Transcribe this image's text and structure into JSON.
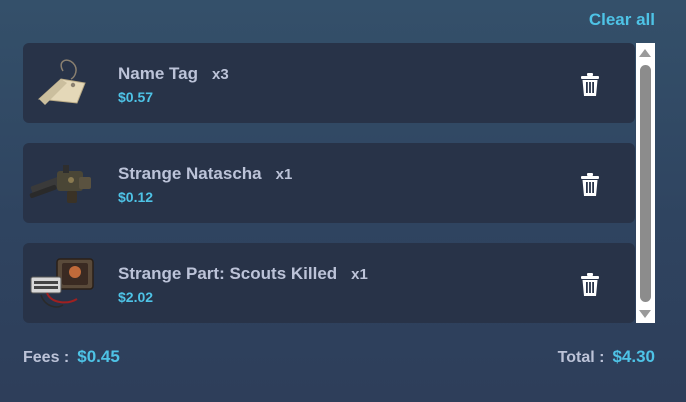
{
  "header": {
    "clear_all_label": "Clear all"
  },
  "cart": {
    "items": [
      {
        "name": "Name Tag",
        "qty": "x3",
        "price": "$0.57",
        "icon": "name-tag-icon"
      },
      {
        "name": "Strange Natascha",
        "qty": "x1",
        "price": "$0.12",
        "icon": "minigun-icon"
      },
      {
        "name": "Strange Part: Scouts Killed",
        "qty": "x1",
        "price": "$2.02",
        "icon": "strange-part-icon"
      }
    ]
  },
  "summary": {
    "fees_label": "Fees :",
    "fees_value": "$0.45",
    "total_label": "Total :",
    "total_value": "$4.30"
  },
  "colors": {
    "accent": "#4ec3e6",
    "card": "#283348",
    "text": "#bcc3d8"
  }
}
